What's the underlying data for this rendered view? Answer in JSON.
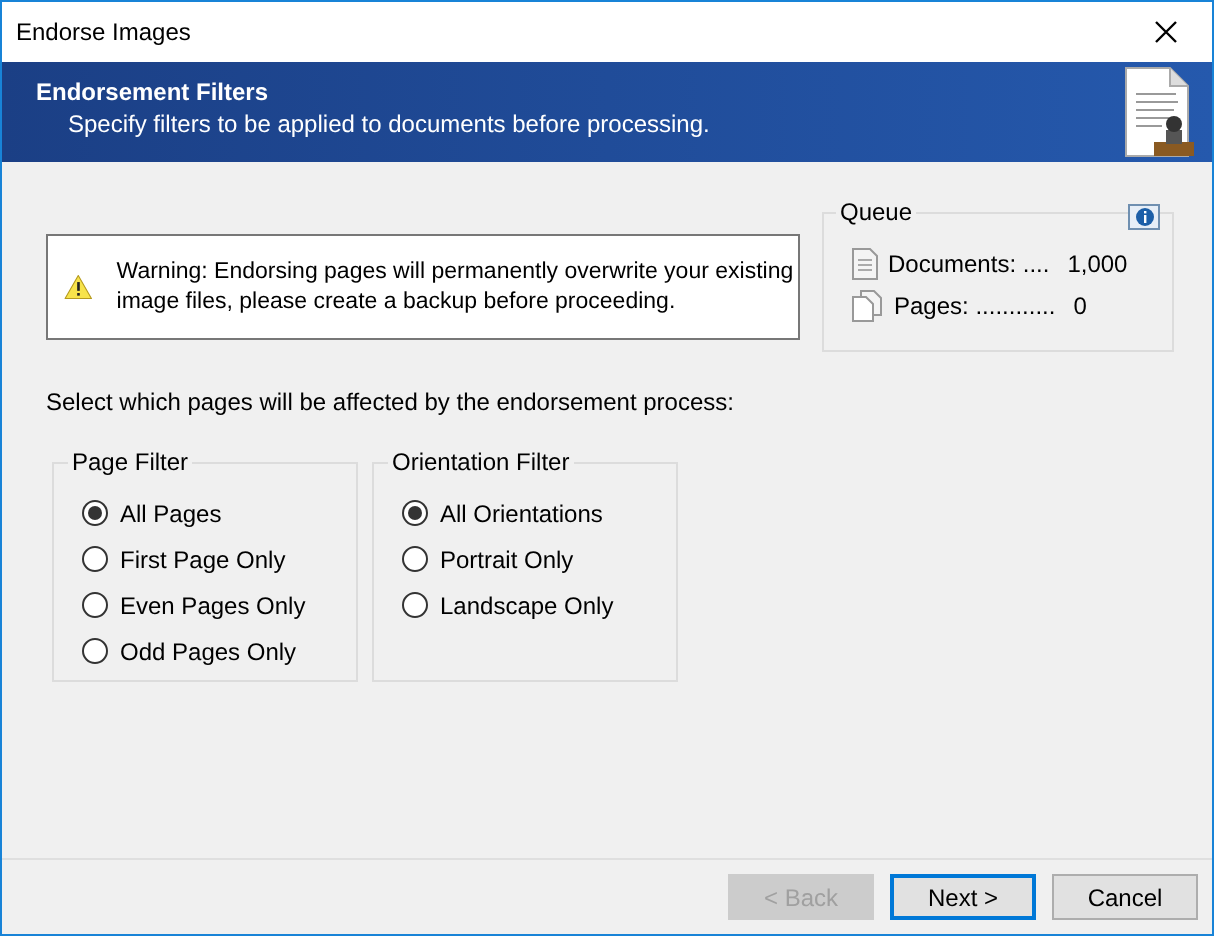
{
  "window": {
    "title": "Endorse Images"
  },
  "header": {
    "title": "Endorsement Filters",
    "subtitle": "Specify filters to be applied to documents before processing."
  },
  "warning": {
    "text": "Warning: Endorsing pages will permanently overwrite your existing image files, please create a backup before proceeding."
  },
  "queue": {
    "title": "Queue",
    "items": [
      {
        "kind": "documents",
        "label": "Documents: ....",
        "value": "1,000"
      },
      {
        "kind": "pages",
        "label": "Pages: ............",
        "value": "0"
      }
    ]
  },
  "prompt": "Select which pages will be affected by the endorsement process:",
  "filters": [
    {
      "title": "Page Filter",
      "options": [
        {
          "label": "All Pages",
          "selected": true
        },
        {
          "label": "First Page Only",
          "selected": false
        },
        {
          "label": "Even Pages Only",
          "selected": false
        },
        {
          "label": "Odd Pages Only",
          "selected": false
        }
      ]
    },
    {
      "title": "Orientation Filter",
      "options": [
        {
          "label": "All Orientations",
          "selected": true
        },
        {
          "label": "Portrait Only",
          "selected": false
        },
        {
          "label": "Landscape Only",
          "selected": false
        }
      ]
    }
  ],
  "buttons": [
    {
      "label": "< Back",
      "disabled": true,
      "default": false
    },
    {
      "label": "Next >",
      "disabled": false,
      "default": true
    },
    {
      "label": "Cancel",
      "disabled": false,
      "default": false
    }
  ]
}
